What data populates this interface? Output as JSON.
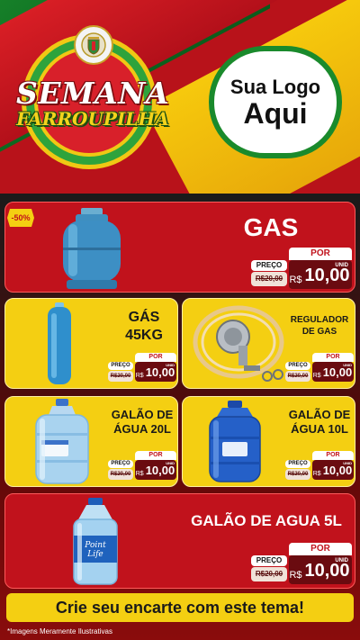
{
  "header": {
    "title_line1": "SEMANA",
    "title_line2": "FARROUPILHA",
    "logo_line1": "Sua Logo",
    "logo_line2": "Aqui"
  },
  "colors": {
    "red": "#c1121c",
    "yellow": "#f4cf12",
    "green": "#1a8a2c",
    "dark_red": "#6a0b10"
  },
  "products": [
    {
      "name": "GAS",
      "discount": "-50%",
      "preco": "PREÇO",
      "por": "POR",
      "old_price": "R$20,00",
      "currency": "R$",
      "price": "10,00",
      "unit": "UNID",
      "icon": "gas-cylinder-icon"
    },
    {
      "name_line1": "GÁS",
      "name_line2": "45KG",
      "preco": "PREÇO",
      "por": "POR",
      "old_price": "R$20,00",
      "currency": "R$",
      "price": "10,00",
      "unit": "UNID",
      "icon": "tall-gas-cylinder-icon"
    },
    {
      "name_line1": "REGULADOR",
      "name_line2": "DE GAS",
      "preco": "PREÇO",
      "por": "POR",
      "old_price": "R$20,00",
      "currency": "R$",
      "price": "10,00",
      "unit": "UNID",
      "icon": "gas-regulator-icon"
    },
    {
      "name_line1": "GALÃO DE",
      "name_line2": "ÁGUA 20L",
      "preco": "PREÇO",
      "por": "POR",
      "old_price": "R$20,00",
      "currency": "R$",
      "price": "10,00",
      "unit": "UNID",
      "icon": "water-jug-20l-icon"
    },
    {
      "name_line1": "GALÃO DE",
      "name_line2": "ÁGUA 10L",
      "preco": "PREÇO",
      "por": "POR",
      "old_price": "R$20,00",
      "currency": "R$",
      "price": "10,00",
      "unit": "UNID",
      "icon": "water-jug-10l-icon"
    },
    {
      "name": "GALÃO DE AGUA 5L",
      "preco": "PREÇO",
      "por": "POR",
      "old_price": "R$20,00",
      "currency": "R$",
      "price": "10,00",
      "unit": "UNID",
      "icon": "water-bottle-5l-icon",
      "bottle_label_line1": "Point",
      "bottle_label_line2": "Life"
    }
  ],
  "cta": "Crie seu encarte com este tema!",
  "disclaimer": "*Imagens Meramente Ilustrativas"
}
